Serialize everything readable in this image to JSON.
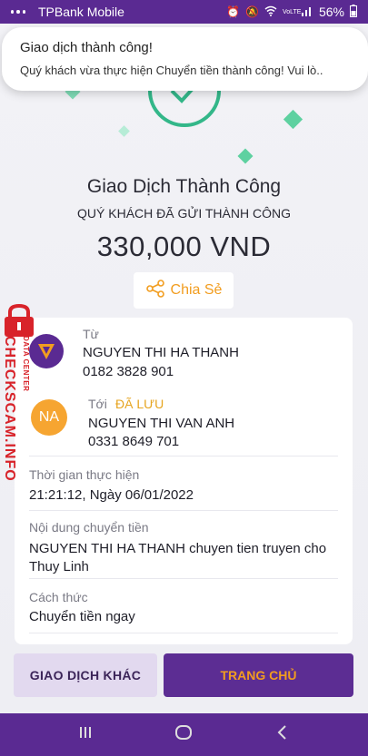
{
  "status_bar": {
    "app_name": "TPBank Mobile",
    "battery": "56%",
    "network": "VoLTE"
  },
  "notification": {
    "title": "Giao dịch thành công!",
    "body": "Quý khách vừa thực hiện Chuyển tiền thành công! Vui lò.."
  },
  "result": {
    "title": "Giao Dịch Thành Công",
    "subtitle": "QUÝ KHÁCH ĐÃ GỬI THÀNH CÔNG",
    "amount": "330,000 VND",
    "share_label": "Chia Sẻ"
  },
  "details": {
    "from_label": "Từ",
    "from_name": "NGUYEN THI HA THANH",
    "from_account": "0182 3828 901",
    "to_label": "Tới",
    "to_saved_tag": "ĐÃ LƯU",
    "to_avatar": "NA",
    "to_name": "NGUYEN THI VAN ANH",
    "to_account": "0331 8649 701",
    "time_label": "Thời gian thực hiện",
    "time_value": "21:21:12, Ngày 06/01/2022",
    "content_label": "Nội dung chuyển tiền",
    "content_value": "NGUYEN THI HA THANH chuyen tien truyen cho Thuy Linh",
    "method_label": "Cách thức",
    "method_value": "Chuyển tiền ngay"
  },
  "actions": {
    "other_label": "GIAO DỊCH KHÁC",
    "home_label": "TRANG CHỦ"
  },
  "watermark": {
    "main": "CHECKSCAM.INFO",
    "small": "DATA CENTER"
  },
  "colors": {
    "brand_purple": "#5a2a92",
    "accent_orange": "#f29d1f",
    "success_green": "#33b789",
    "watermark_red": "#d8232a"
  }
}
